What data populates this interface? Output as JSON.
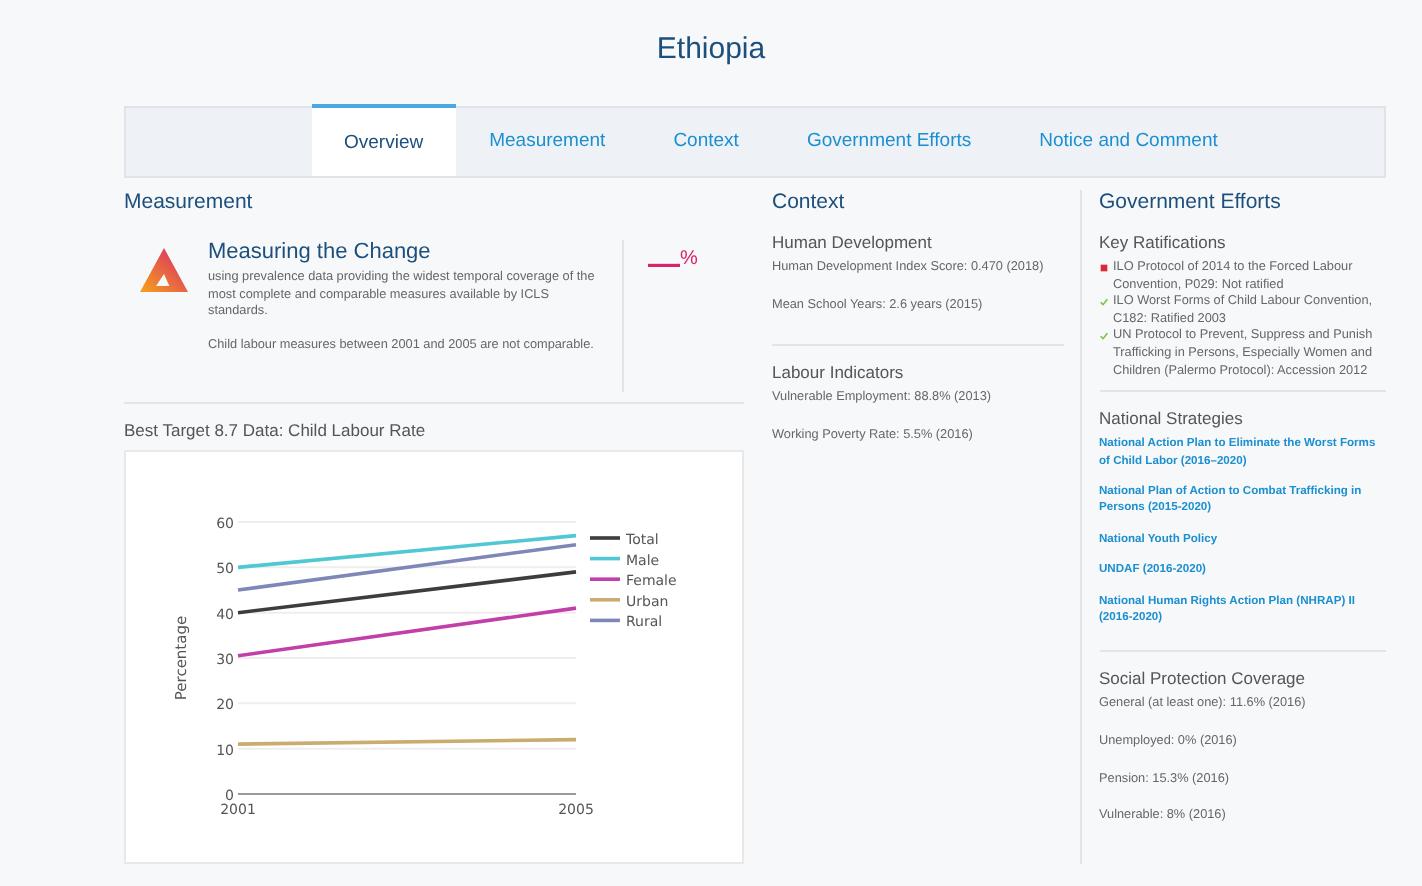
{
  "page_title": "Ethiopia",
  "tabs": [
    {
      "label": "Overview",
      "selected": true
    },
    {
      "label": "Measurement",
      "selected": false
    },
    {
      "label": "Context",
      "selected": false
    },
    {
      "label": "Government Efforts",
      "selected": false
    },
    {
      "label": "Notice and Comment",
      "selected": false
    }
  ],
  "measurement": {
    "heading": "Measurement",
    "card_title": "Measuring the Change",
    "paragraphs": [
      "using prevalence data providing the widest temporal coverage of the most complete and comparable measures available by ICLS standards.",
      "Child labour measures between 2001 and 2005 are not comparable."
    ],
    "value": "—",
    "unit": "%",
    "chart_title": "Best Target 8.7 Data: Child Labour Rate",
    "chart_data": {
      "type": "line",
      "ylabel": "Percentage",
      "x": [
        2001,
        2005
      ],
      "xlim": [
        2001,
        2005
      ],
      "grid": true,
      "legend": true,
      "xticks": [
        2001,
        2005
      ],
      "yticks": [
        0,
        10,
        20,
        30,
        40,
        50,
        60
      ],
      "ylim": [
        0,
        60
      ],
      "series": [
        {
          "name": "Total",
          "color": "#3d3d3d",
          "values": [
            40,
            49
          ]
        },
        {
          "name": "Male",
          "color": "#4fc8d3",
          "values": [
            50,
            57
          ]
        },
        {
          "name": "Female",
          "color": "#c23fa8",
          "values": [
            30.5,
            41
          ]
        },
        {
          "name": "Urban",
          "color": "#c9ad6e",
          "values": [
            11,
            12
          ]
        },
        {
          "name": "Rural",
          "color": "#7f86b8",
          "values": [
            45,
            55
          ]
        }
      ]
    }
  },
  "context": {
    "heading": "Context",
    "groups": [
      {
        "title": "Human Development",
        "items": [
          "Human Development Index Score: 0.470 (2018)",
          "Mean School Years: 2.6 years (2015)"
        ]
      },
      {
        "title": "Labour Indicators",
        "items": [
          "Vulnerable Employment: 88.8% (2013)",
          "Working Poverty Rate: 5.5% (2016)"
        ]
      }
    ]
  },
  "government_efforts": {
    "heading": "Government Efforts",
    "ratifications_title": "Key Ratifications",
    "ratifications": [
      {
        "text": "ILO Protocol of 2014 to the Forced Labour Convention, P029: Not ratified",
        "ratified": false
      },
      {
        "text": "ILO Worst Forms of Child Labour Convention, C182: Ratified 2003",
        "ratified": true
      },
      {
        "text": "UN Protocol to Prevent, Suppress and Punish Trafficking in Persons, Especially Women and Children (Palermo Protocol): Accession 2012",
        "ratified": true
      }
    ],
    "strategies_title": "National Strategies",
    "strategies": [
      "National Action Plan to Eliminate the Worst Forms of Child Labor (2016–2020)",
      "National Plan of Action to Combat Trafficking in Persons (2015-2020)",
      "National Youth Policy",
      "UNDAF (2016-2020)",
      "National Human Rights Action Plan (NHRAP) II (2016-2020)"
    ],
    "social_title": "Social Protection Coverage",
    "social": [
      "General (at least one): 11.6% (2016)",
      "Unemployed: 0% (2016)",
      "Pension: 15.3% (2016)",
      "Vulnerable: 8% (2016)"
    ]
  }
}
